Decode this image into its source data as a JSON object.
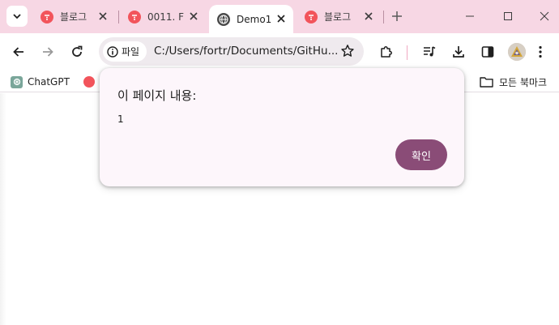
{
  "tabs": [
    {
      "title": "블로그",
      "favicon": "tistory-icon",
      "active": false
    },
    {
      "title": "0011. F",
      "favicon": "tistory-icon",
      "active": false
    },
    {
      "title": "Demo1",
      "favicon": "globe-icon",
      "active": true
    },
    {
      "title": "블로그",
      "favicon": "tistory-icon",
      "active": false
    }
  ],
  "address_bar": {
    "chip_label": "파일",
    "url": "C:/Users/fortr/Documents/GitHu..."
  },
  "bookmarks": {
    "items": [
      {
        "label": "ChatGPT",
        "icon": "chatgpt-icon"
      }
    ],
    "all_bookmarks": "모든 북마크"
  },
  "dialog": {
    "title": "이 페이지 내용:",
    "message": "1",
    "ok_label": "확인"
  },
  "colors": {
    "tabstrip": "#f7d7e4",
    "tistory_red": "#f2545b",
    "dialog_bg": "#fdf6fb",
    "ok_button": "#8a4c77"
  }
}
